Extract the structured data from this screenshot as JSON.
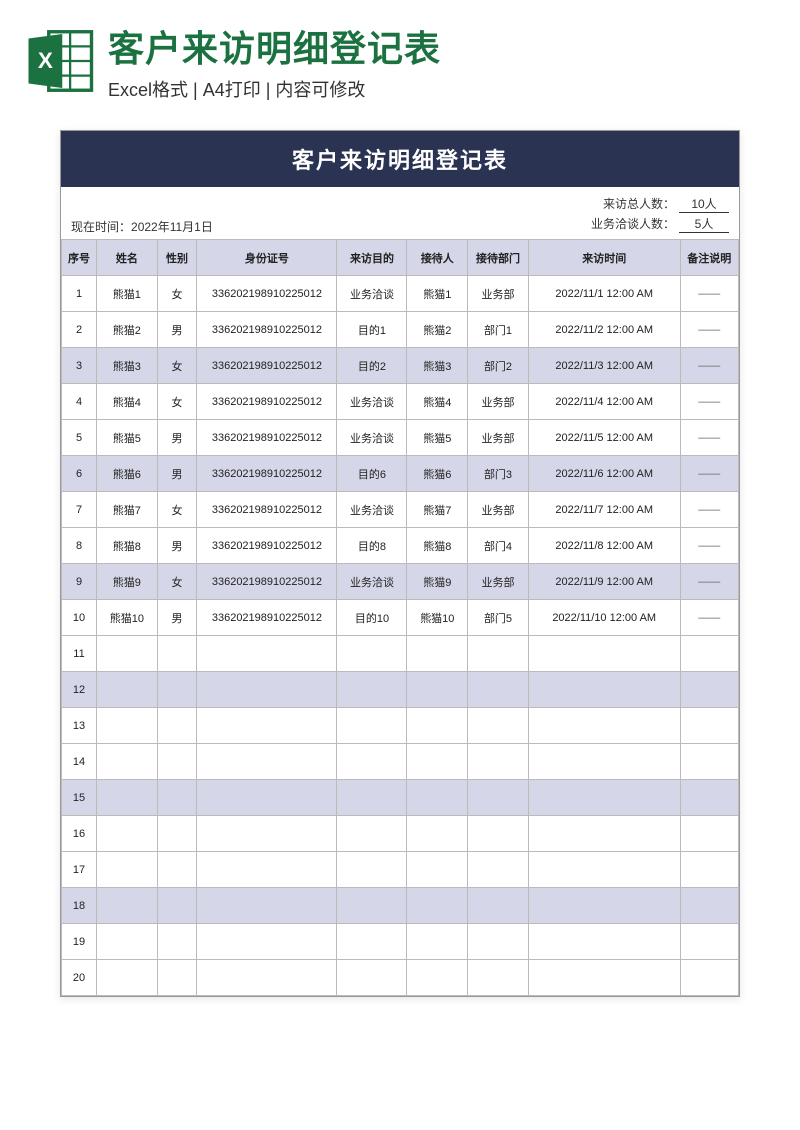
{
  "header": {
    "title": "客户来访明细登记表",
    "subtitle": "Excel格式 | A4打印 | 内容可修改"
  },
  "sheet": {
    "title": "客户来访明细登记表",
    "current_time_label": "现在时间：",
    "current_time": "2022年11月1日",
    "total_label": "来访总人数：",
    "total_value": "10人",
    "business_label": "业务洽谈人数：",
    "business_value": "5人"
  },
  "columns": {
    "seq": "序号",
    "name": "姓名",
    "gender": "性别",
    "id": "身份证号",
    "purpose": "来访目的",
    "receiver": "接待人",
    "dept": "接待部门",
    "time": "来访时间",
    "note": "备注说明"
  },
  "rows": [
    {
      "seq": "1",
      "name": "熊猫1",
      "gender": "女",
      "id": "336202198910225012",
      "purpose": "业务洽谈",
      "receiver": "熊猫1",
      "dept": "业务部",
      "time": "2022/11/1 12:00 AM",
      "note": "——"
    },
    {
      "seq": "2",
      "name": "熊猫2",
      "gender": "男",
      "id": "336202198910225012",
      "purpose": "目的1",
      "receiver": "熊猫2",
      "dept": "部门1",
      "time": "2022/11/2 12:00 AM",
      "note": "——"
    },
    {
      "seq": "3",
      "name": "熊猫3",
      "gender": "女",
      "id": "336202198910225012",
      "purpose": "目的2",
      "receiver": "熊猫3",
      "dept": "部门2",
      "time": "2022/11/3 12:00 AM",
      "note": "——"
    },
    {
      "seq": "4",
      "name": "熊猫4",
      "gender": "女",
      "id": "336202198910225012",
      "purpose": "业务洽谈",
      "receiver": "熊猫4",
      "dept": "业务部",
      "time": "2022/11/4 12:00 AM",
      "note": "——"
    },
    {
      "seq": "5",
      "name": "熊猫5",
      "gender": "男",
      "id": "336202198910225012",
      "purpose": "业务洽谈",
      "receiver": "熊猫5",
      "dept": "业务部",
      "time": "2022/11/5 12:00 AM",
      "note": "——"
    },
    {
      "seq": "6",
      "name": "熊猫6",
      "gender": "男",
      "id": "336202198910225012",
      "purpose": "目的6",
      "receiver": "熊猫6",
      "dept": "部门3",
      "time": "2022/11/6 12:00 AM",
      "note": "——"
    },
    {
      "seq": "7",
      "name": "熊猫7",
      "gender": "女",
      "id": "336202198910225012",
      "purpose": "业务洽谈",
      "receiver": "熊猫7",
      "dept": "业务部",
      "time": "2022/11/7 12:00 AM",
      "note": "——"
    },
    {
      "seq": "8",
      "name": "熊猫8",
      "gender": "男",
      "id": "336202198910225012",
      "purpose": "目的8",
      "receiver": "熊猫8",
      "dept": "部门4",
      "time": "2022/11/8 12:00 AM",
      "note": "——"
    },
    {
      "seq": "9",
      "name": "熊猫9",
      "gender": "女",
      "id": "336202198910225012",
      "purpose": "业务洽谈",
      "receiver": "熊猫9",
      "dept": "业务部",
      "time": "2022/11/9 12:00 AM",
      "note": "——"
    },
    {
      "seq": "10",
      "name": "熊猫10",
      "gender": "男",
      "id": "336202198910225012",
      "purpose": "目的10",
      "receiver": "熊猫10",
      "dept": "部门5",
      "time": "2022/11/10 12:00 AM",
      "note": "——"
    },
    {
      "seq": "11",
      "name": "",
      "gender": "",
      "id": "",
      "purpose": "",
      "receiver": "",
      "dept": "",
      "time": "",
      "note": ""
    },
    {
      "seq": "12",
      "name": "",
      "gender": "",
      "id": "",
      "purpose": "",
      "receiver": "",
      "dept": "",
      "time": "",
      "note": ""
    },
    {
      "seq": "13",
      "name": "",
      "gender": "",
      "id": "",
      "purpose": "",
      "receiver": "",
      "dept": "",
      "time": "",
      "note": ""
    },
    {
      "seq": "14",
      "name": "",
      "gender": "",
      "id": "",
      "purpose": "",
      "receiver": "",
      "dept": "",
      "time": "",
      "note": ""
    },
    {
      "seq": "15",
      "name": "",
      "gender": "",
      "id": "",
      "purpose": "",
      "receiver": "",
      "dept": "",
      "time": "",
      "note": ""
    },
    {
      "seq": "16",
      "name": "",
      "gender": "",
      "id": "",
      "purpose": "",
      "receiver": "",
      "dept": "",
      "time": "",
      "note": ""
    },
    {
      "seq": "17",
      "name": "",
      "gender": "",
      "id": "",
      "purpose": "",
      "receiver": "",
      "dept": "",
      "time": "",
      "note": ""
    },
    {
      "seq": "18",
      "name": "",
      "gender": "",
      "id": "",
      "purpose": "",
      "receiver": "",
      "dept": "",
      "time": "",
      "note": ""
    },
    {
      "seq": "19",
      "name": "",
      "gender": "",
      "id": "",
      "purpose": "",
      "receiver": "",
      "dept": "",
      "time": "",
      "note": ""
    },
    {
      "seq": "20",
      "name": "",
      "gender": "",
      "id": "",
      "purpose": "",
      "receiver": "",
      "dept": "",
      "time": "",
      "note": ""
    }
  ],
  "alt_rows": [
    3,
    6,
    9,
    12,
    15,
    18
  ]
}
